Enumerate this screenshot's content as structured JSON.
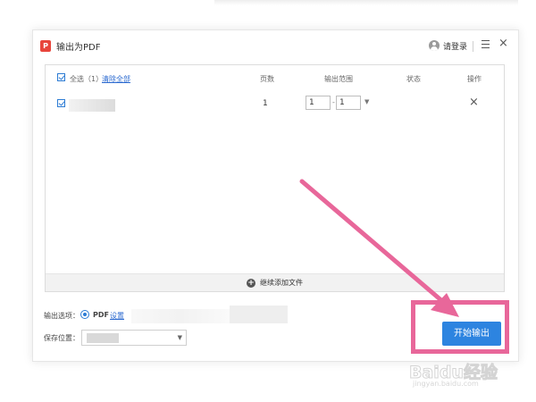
{
  "window": {
    "title": "输出为PDF",
    "logo_text": "P",
    "login_label": "请登录",
    "close_glyph": "×"
  },
  "file_list": {
    "header": {
      "select_all": "全选（1）",
      "clear_all": "清除全部",
      "pages": "页数",
      "output_range": "输出范围",
      "status": "状态",
      "action": "操作"
    },
    "rows": [
      {
        "checked": true,
        "pages": "1",
        "range_from": "1",
        "range_separator": "-",
        "range_to": "1",
        "remove_glyph": "×"
      }
    ],
    "add_files_label": "继续添加文件"
  },
  "options": {
    "output_label": "输出选项：",
    "format": "PDF",
    "settings_label": "设置",
    "save_label": "保存位置："
  },
  "actions": {
    "start_label": "开始输出"
  },
  "annotation": {
    "color": "#e8679a"
  },
  "watermark": {
    "logo": "Baidu经验",
    "url": "jingyan.baidu.com"
  },
  "colors": {
    "primary": "#2d84e0",
    "link": "#2d6bd0",
    "pdf_red": "#e8453c"
  }
}
